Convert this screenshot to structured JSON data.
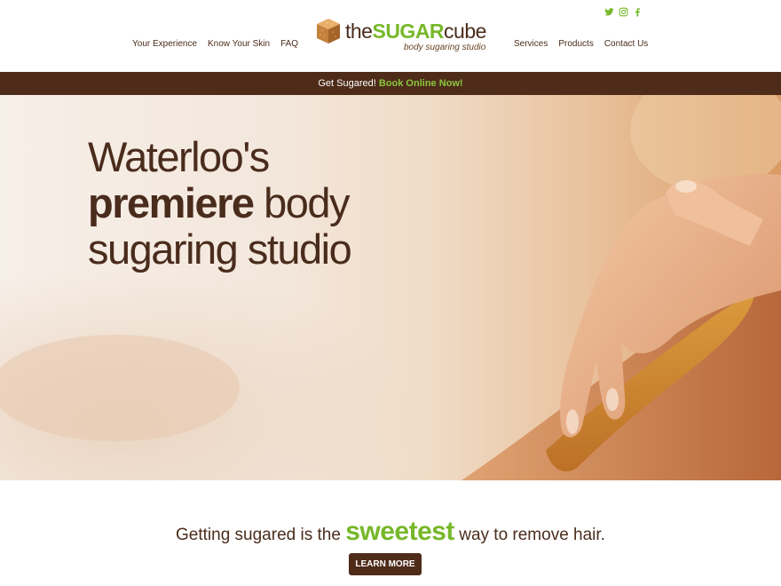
{
  "header": {
    "social": {
      "icons": [
        "twitter-icon",
        "instagram-icon",
        "facebook-icon"
      ],
      "color": "#77b82a"
    },
    "nav_left": [
      {
        "label": "Your Experience"
      },
      {
        "label": "Know Your Skin"
      },
      {
        "label": "FAQ"
      }
    ],
    "nav_right": [
      {
        "label": "Services"
      },
      {
        "label": "Products"
      },
      {
        "label": "Contact Us"
      }
    ],
    "logo": {
      "the": "the",
      "sugar": "SUGAR",
      "cube": "cube",
      "tagline": "body sugaring studio"
    }
  },
  "promo": {
    "text": "Get Sugared!",
    "link": "Book Online Now!"
  },
  "hero": {
    "line1": "Waterloo's",
    "bold": "premiere",
    "line2_rest": "body",
    "line3": "sugaring studio"
  },
  "intro": {
    "before": "Getting sugared is the",
    "highlight": "sweetest",
    "after": "way to remove hair.",
    "button": "LEARN MORE"
  },
  "colors": {
    "brown": "#4e2c19",
    "green": "#77b82a",
    "text": "#4a2c1c"
  }
}
